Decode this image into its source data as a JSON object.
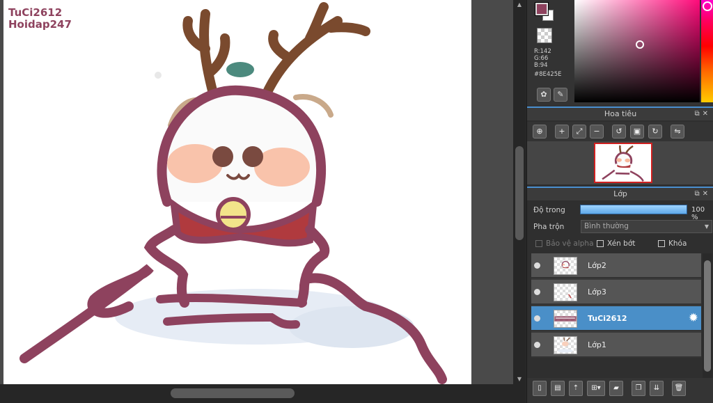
{
  "canvas": {
    "watermark_line1": "TuCi2612",
    "watermark_line2": "Hoidap247"
  },
  "color": {
    "current_hex": "#8E425E",
    "r_label": "R:142",
    "g_label": "G:66",
    "b_label": "B:94",
    "hex_label": "#8E425E",
    "palette_icon": "palette-icon",
    "picker_icon": "color-picker-icon"
  },
  "navigator": {
    "title": "Hoa tiêu",
    "tools": [
      "zoom-fit-icon",
      "zoom-in-icon",
      "fit-screen-icon",
      "zoom-out-icon",
      "rotate-left-icon",
      "actual-size-icon",
      "rotate-right-icon",
      "flip-icon"
    ]
  },
  "layers": {
    "title": "Lớp",
    "opacity_label": "Độ trong",
    "opacity_value": "100 %",
    "opacity_fraction": 1.0,
    "blend_label": "Pha trộn",
    "blend_value": "Bình thường",
    "protect_alpha": "Bảo vệ alpha",
    "clipping": "Xén bớt",
    "lock": "Khóa",
    "items": [
      {
        "name": "Lớp2",
        "selected": false
      },
      {
        "name": "Lớp3",
        "selected": false
      },
      {
        "name": "TuCi2612",
        "selected": true
      },
      {
        "name": "Lớp1",
        "selected": false
      }
    ]
  }
}
